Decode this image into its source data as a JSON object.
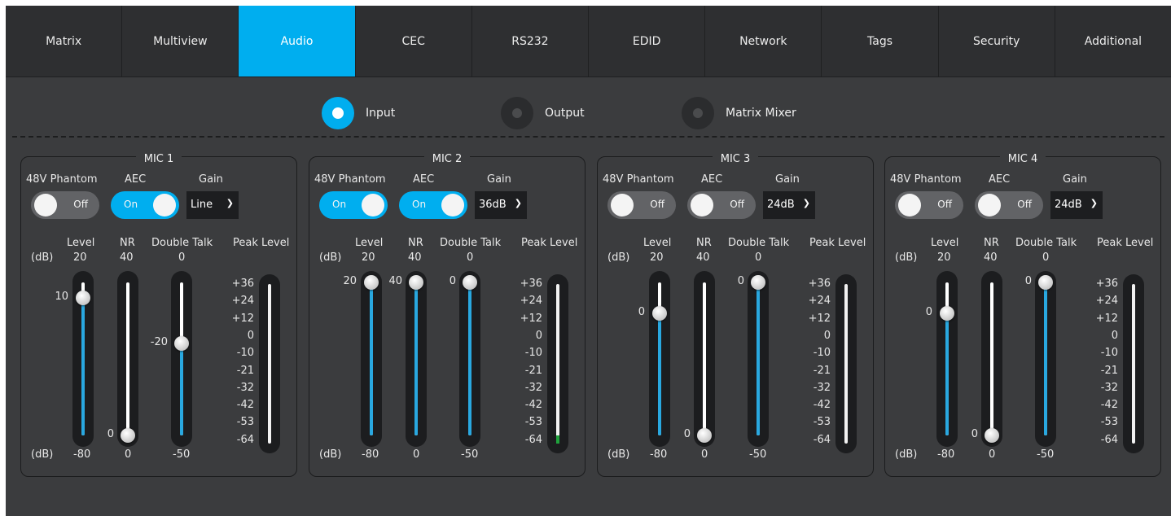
{
  "tabs": [
    {
      "label": "Matrix",
      "active": false
    },
    {
      "label": "Multiview",
      "active": false
    },
    {
      "label": "Audio",
      "active": true
    },
    {
      "label": "CEC",
      "active": false
    },
    {
      "label": "RS232",
      "active": false
    },
    {
      "label": "EDID",
      "active": false
    },
    {
      "label": "Network",
      "active": false
    },
    {
      "label": "Tags",
      "active": false
    },
    {
      "label": "Security",
      "active": false
    },
    {
      "label": "Additional",
      "active": false
    }
  ],
  "mode": {
    "options": [
      {
        "label": "Input",
        "selected": true
      },
      {
        "label": "Output",
        "selected": false
      },
      {
        "label": "Matrix Mixer",
        "selected": false
      }
    ]
  },
  "labels": {
    "phantom": "48V Phantom",
    "aec": "AEC",
    "gain": "Gain",
    "level": "Level",
    "nr": "NR",
    "double_talk": "Double Talk",
    "peak_level": "Peak Level",
    "db": "(dB)",
    "level_max": "20",
    "level_min": "-80",
    "nr_max": "40",
    "nr_min": "0",
    "dt_max": "0",
    "dt_min": "-50"
  },
  "peak_scale": [
    "+36",
    "+24",
    "+12",
    "0",
    "-10",
    "-21",
    "-32",
    "-42",
    "-53",
    "-64"
  ],
  "mics": [
    {
      "title": "MIC 1",
      "phantom": {
        "on": false,
        "text": "Off"
      },
      "aec": {
        "on": true,
        "text": "On"
      },
      "gain": "Line",
      "level": {
        "value": "10",
        "fraction": 0.9
      },
      "nr": {
        "value": "0",
        "fraction": 0.0
      },
      "double_talk": {
        "value": "-20",
        "fraction": 0.6
      },
      "peak_fraction": 0.0
    },
    {
      "title": "MIC 2",
      "phantom": {
        "on": true,
        "text": "On"
      },
      "aec": {
        "on": true,
        "text": "On"
      },
      "gain": "36dB",
      "level": {
        "value": "20",
        "fraction": 1.0
      },
      "nr": {
        "value": "40",
        "fraction": 1.0
      },
      "double_talk": {
        "value": "0",
        "fraction": 1.0
      },
      "peak_fraction": 0.05
    },
    {
      "title": "MIC 3",
      "phantom": {
        "on": false,
        "text": "Off"
      },
      "aec": {
        "on": false,
        "text": "Off"
      },
      "gain": "24dB",
      "level": {
        "value": "0",
        "fraction": 0.8
      },
      "nr": {
        "value": "0",
        "fraction": 0.0
      },
      "double_talk": {
        "value": "0",
        "fraction": 1.0
      },
      "peak_fraction": 0.0
    },
    {
      "title": "MIC 4",
      "phantom": {
        "on": false,
        "text": "Off"
      },
      "aec": {
        "on": false,
        "text": "Off"
      },
      "gain": "24dB",
      "level": {
        "value": "0",
        "fraction": 0.8
      },
      "nr": {
        "value": "0",
        "fraction": 0.0
      },
      "double_talk": {
        "value": "0",
        "fraction": 1.0
      },
      "peak_fraction": 0.0
    }
  ]
}
